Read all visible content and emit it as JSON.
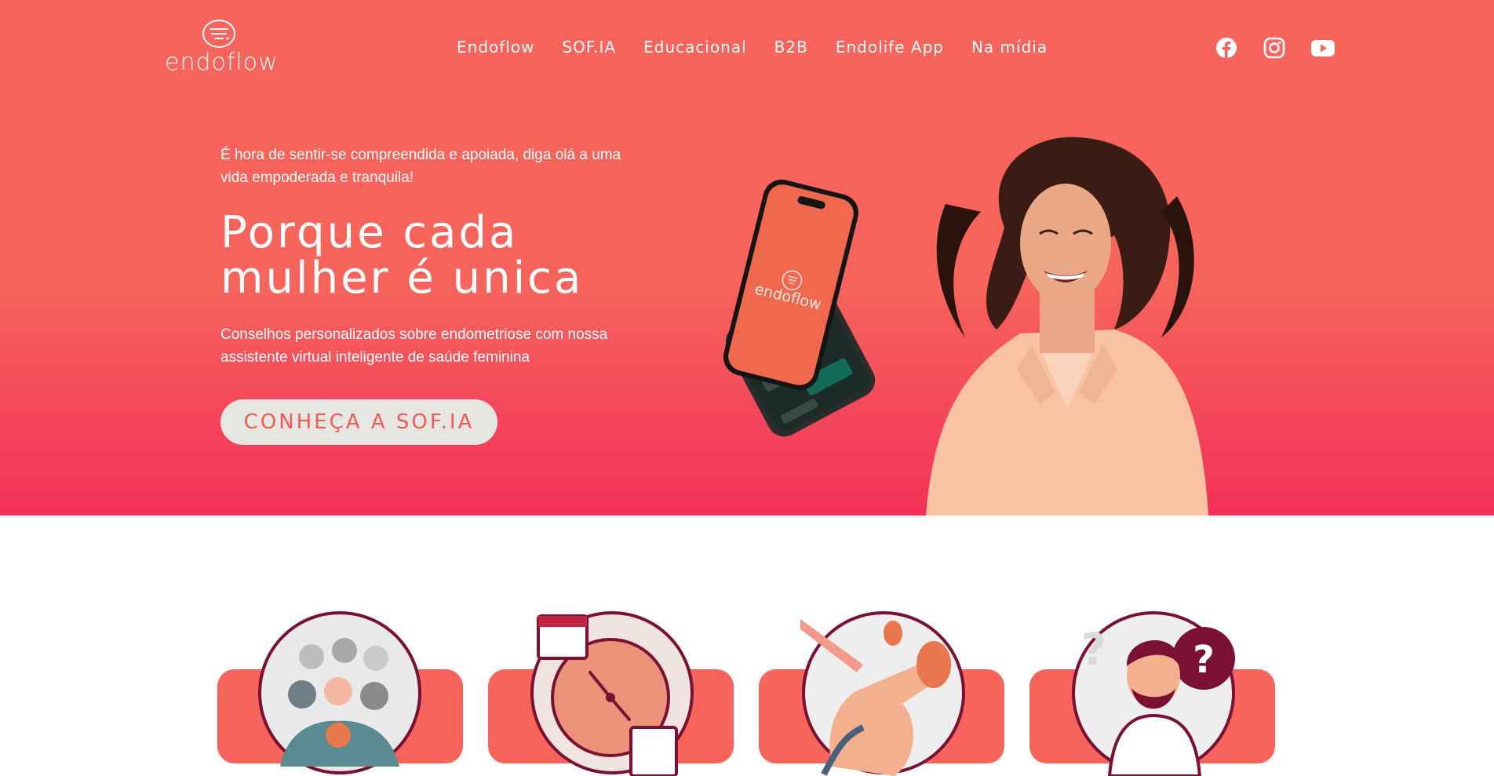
{
  "brand": {
    "logo_text": "endoflow"
  },
  "nav": {
    "items": [
      {
        "label": "Endoflow"
      },
      {
        "label": "SOF.IA"
      },
      {
        "label": "Educacional"
      },
      {
        "label": "B2B"
      },
      {
        "label": "Endolife App"
      },
      {
        "label": "Na mídia"
      }
    ]
  },
  "social": [
    "facebook-icon",
    "instagram-icon",
    "youtube-icon"
  ],
  "hero": {
    "tagline": "É hora de sentir-se compreendida e apoiada, diga olá a uma vida empoderada e tranquila!",
    "headline_line1": "Porque cada",
    "headline_line2": "mulher é unica",
    "subtext": "Conselhos personalizados sobre endometriose com nossa assistente virtual inteligente de saúde feminina",
    "cta_label": "CONHEÇA A SOF.IA",
    "phone_logo_text": "endoflow"
  },
  "colors": {
    "hero_top": "#f6645c",
    "hero_bottom": "#f3305a",
    "cta_bg": "#e6e7e2",
    "cta_text": "#ef5a52",
    "card_bg": "#f6645c",
    "dark_accent": "#7a1033"
  },
  "cards": [
    {
      "icon": "women-crowd-illustration"
    },
    {
      "icon": "clock-calendar-illustration"
    },
    {
      "icon": "hand-flower-illustration"
    },
    {
      "icon": "doctor-question-illustration"
    }
  ]
}
